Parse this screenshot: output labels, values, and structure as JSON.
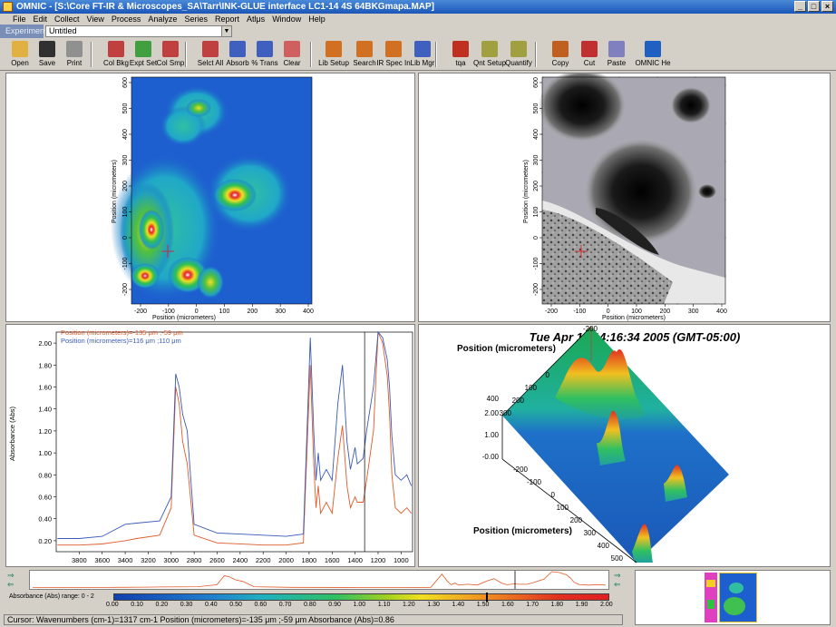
{
  "window": {
    "title": "OMNIC - [S:\\Core FT-IR & Microscopes_SA\\Tarr\\INK-GLUE interface LC1-14 4S 64BKGmapa.MAP]"
  },
  "menu": [
    "File",
    "Edit",
    "Collect",
    "View",
    "Process",
    "Analyze",
    "Series",
    "Report",
    "Atlμs",
    "Window",
    "Help"
  ],
  "experiment": {
    "label": "Experiment",
    "value": "Untitled"
  },
  "toolbar": [
    {
      "label": "Open",
      "icon": "folder-open-icon",
      "color": "#e0b040"
    },
    {
      "label": "Save",
      "icon": "floppy-disk-icon",
      "color": "#303030"
    },
    {
      "label": "Print",
      "icon": "printer-icon",
      "color": "#909090"
    },
    {
      "label": "Col Bkg",
      "icon": "collect-background-icon",
      "color": "#c04040"
    },
    {
      "label": "Expt Set",
      "icon": "experiment-setup-icon",
      "color": "#40a040"
    },
    {
      "label": "Col Smp",
      "icon": "collect-sample-icon",
      "color": "#c04040"
    },
    {
      "label": "Selct All",
      "icon": "select-all-icon",
      "color": "#c04040"
    },
    {
      "label": "Absorb",
      "icon": "absorbance-icon",
      "color": "#4060c0"
    },
    {
      "label": "% Trans",
      "icon": "transmittance-icon",
      "color": "#4060c0"
    },
    {
      "label": "Clear",
      "icon": "clear-icon",
      "color": "#d06060"
    },
    {
      "label": "Lib Setup",
      "icon": "library-setup-icon",
      "color": "#d07020"
    },
    {
      "label": "Search",
      "icon": "search-icon",
      "color": "#d07020"
    },
    {
      "label": "IR Spec In",
      "icon": "ir-spec-interpret-icon",
      "color": "#d07020"
    },
    {
      "label": "Lib Mgr",
      "icon": "library-manager-icon",
      "color": "#4060c0"
    },
    {
      "label": "tqa",
      "icon": "tqa-icon",
      "color": "#c03020"
    },
    {
      "label": "Qnt Setup",
      "icon": "quant-setup-icon",
      "color": "#a0a040"
    },
    {
      "label": "Quantify",
      "icon": "quantify-icon",
      "color": "#a0a040"
    },
    {
      "label": "Copy",
      "icon": "copy-icon",
      "color": "#c06020"
    },
    {
      "label": "Cut",
      "icon": "scissors-icon",
      "color": "#c03030"
    },
    {
      "label": "Paste",
      "icon": "paste-icon",
      "color": "#8080c0"
    },
    {
      "label": "OMNIC He",
      "icon": "help-icon",
      "color": "#2060c0"
    }
  ],
  "map": {
    "xlabel": "Position (micrometers)",
    "ylabel": "Position (micrometers)",
    "xticks": [
      "-200",
      "-100",
      "0",
      "100",
      "200",
      "300",
      "400"
    ],
    "yticks": [
      "600",
      "500",
      "400",
      "300",
      "200",
      "100",
      "0",
      "-100",
      "-200"
    ]
  },
  "video": {
    "xlabel": "Position (micrometers)",
    "ylabel": "Position (micrometers)",
    "xticks": [
      "-200",
      "-100",
      "0",
      "100",
      "200",
      "300",
      "400"
    ],
    "yticks": [
      "600",
      "500",
      "400",
      "300",
      "200",
      "100",
      "0",
      "-100",
      "-200"
    ]
  },
  "chart_data": {
    "type": "line",
    "xlabel": "",
    "ylabel": "Absorbance (Abs)",
    "xlim": [
      4000,
      900
    ],
    "ylim": [
      0.1,
      2.1
    ],
    "xticks": [
      "3800",
      "3600",
      "3400",
      "3200",
      "3000",
      "2800",
      "2600",
      "2400",
      "2200",
      "2000",
      "1800",
      "1600",
      "1400",
      "1200",
      "1000"
    ],
    "yticks": [
      "2.00",
      "1.80",
      "1.60",
      "1.40",
      "1.20",
      "1.00",
      "0.80",
      "0.60",
      "0.40",
      "0.20"
    ],
    "cursor_x": 1317,
    "series": [
      {
        "name": "Position (micrometers)=-135 μm ;-59 μm",
        "color": "#e05a2a",
        "points": [
          [
            3990,
            0.16
          ],
          [
            3800,
            0.16
          ],
          [
            3600,
            0.17
          ],
          [
            3400,
            0.2
          ],
          [
            3300,
            0.22
          ],
          [
            3100,
            0.25
          ],
          [
            3000,
            0.5
          ],
          [
            2960,
            1.6
          ],
          [
            2930,
            1.45
          ],
          [
            2900,
            1.1
          ],
          [
            2860,
            0.9
          ],
          [
            2800,
            0.25
          ],
          [
            2600,
            0.18
          ],
          [
            2200,
            0.16
          ],
          [
            2000,
            0.16
          ],
          [
            1850,
            0.18
          ],
          [
            1790,
            1.8
          ],
          [
            1760,
            0.9
          ],
          [
            1740,
            0.5
          ],
          [
            1720,
            0.7
          ],
          [
            1700,
            0.45
          ],
          [
            1650,
            0.55
          ],
          [
            1600,
            0.45
          ],
          [
            1550,
            0.95
          ],
          [
            1510,
            1.25
          ],
          [
            1470,
            0.7
          ],
          [
            1440,
            0.5
          ],
          [
            1400,
            0.6
          ],
          [
            1380,
            0.55
          ],
          [
            1330,
            0.55
          ],
          [
            1300,
            0.75
          ],
          [
            1240,
            1.2
          ],
          [
            1200,
            2.1
          ],
          [
            1160,
            2.0
          ],
          [
            1120,
            1.7
          ],
          [
            1100,
            1.35
          ],
          [
            1080,
            0.8
          ],
          [
            1050,
            0.5
          ],
          [
            1000,
            0.45
          ],
          [
            950,
            0.5
          ],
          [
            910,
            0.45
          ]
        ]
      },
      {
        "name": "Position (micrometers)=116 μm ;110 μm",
        "color": "#3a5ab8",
        "points": [
          [
            3990,
            0.22
          ],
          [
            3800,
            0.22
          ],
          [
            3600,
            0.24
          ],
          [
            3400,
            0.35
          ],
          [
            3300,
            0.36
          ],
          [
            3100,
            0.38
          ],
          [
            3000,
            0.6
          ],
          [
            2960,
            1.72
          ],
          [
            2930,
            1.6
          ],
          [
            2900,
            1.35
          ],
          [
            2860,
            1.2
          ],
          [
            2800,
            0.35
          ],
          [
            2600,
            0.27
          ],
          [
            2200,
            0.25
          ],
          [
            2000,
            0.24
          ],
          [
            1850,
            0.26
          ],
          [
            1790,
            2.05
          ],
          [
            1760,
            1.2
          ],
          [
            1740,
            0.75
          ],
          [
            1720,
            1.0
          ],
          [
            1700,
            0.75
          ],
          [
            1650,
            0.85
          ],
          [
            1600,
            0.75
          ],
          [
            1550,
            1.45
          ],
          [
            1510,
            1.8
          ],
          [
            1470,
            1.1
          ],
          [
            1440,
            0.85
          ],
          [
            1400,
            1.05
          ],
          [
            1380,
            0.9
          ],
          [
            1330,
            0.95
          ],
          [
            1300,
            1.2
          ],
          [
            1240,
            1.6
          ],
          [
            1200,
            2.1
          ],
          [
            1160,
            2.05
          ],
          [
            1120,
            1.85
          ],
          [
            1100,
            1.6
          ],
          [
            1080,
            1.15
          ],
          [
            1050,
            0.8
          ],
          [
            1000,
            0.75
          ],
          [
            950,
            0.8
          ],
          [
            910,
            0.7
          ]
        ]
      }
    ]
  },
  "surface": {
    "timestamp": "Tue Apr 12 14:16:34 2005 (GMT-05:00)",
    "axis_label_top": "Position (micrometers)",
    "axis_label_bottom": "Position (micrometers)",
    "left_ticks": [
      "-200",
      "0",
      "100",
      "200",
      "300",
      "400"
    ],
    "z_ticks": [
      "2.00",
      "1.00",
      "-0.00"
    ],
    "bottom_ticks": [
      "-200",
      "-100",
      "0",
      "100",
      "200",
      "300",
      "400",
      "500"
    ]
  },
  "colorbar": {
    "label": "Absorbance (Abs) range: 0 - 2",
    "ticks": [
      "0.00",
      "0.10",
      "0.20",
      "0.30",
      "0.40",
      "0.50",
      "0.60",
      "0.70",
      "0.80",
      "0.90",
      "1.00",
      "1.10",
      "1.20",
      "1.30",
      "1.40",
      "1.50",
      "1.60",
      "1.70",
      "1.80",
      "1.90",
      "2.00"
    ]
  },
  "status": {
    "text": "Cursor: Wavenumbers (cm-1)=1317 cm-1  Position (micrometers)=-135 μm ;-59 μm  Absorbance (Abs)=0.86"
  }
}
